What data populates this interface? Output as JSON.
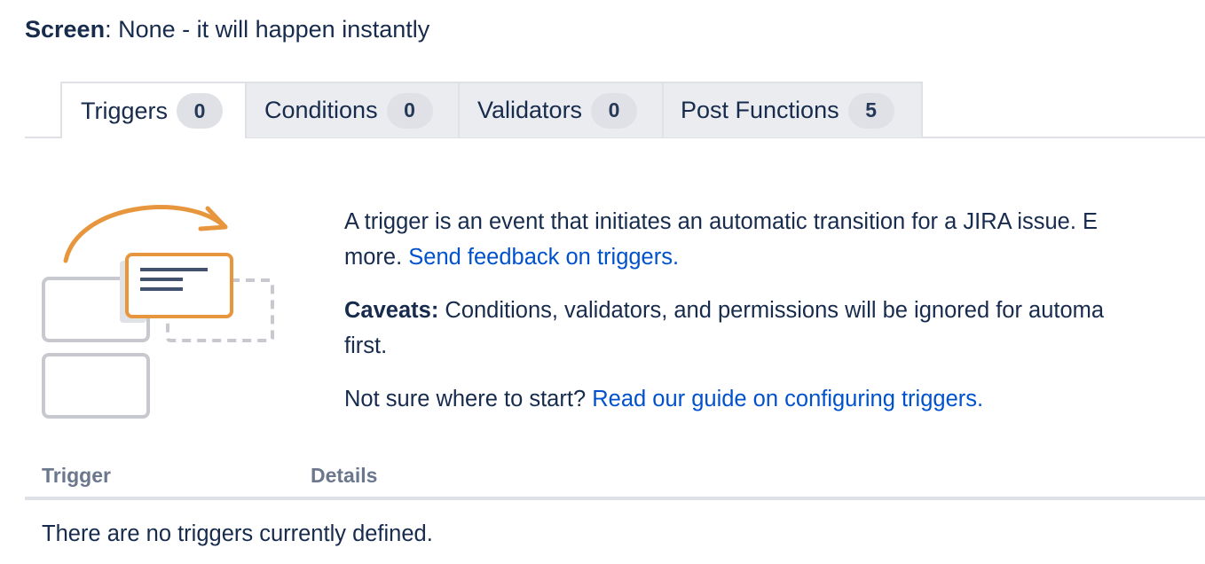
{
  "screen": {
    "label": "Screen",
    "value": ": None - it will happen instantly"
  },
  "tabs": [
    {
      "label": "Triggers",
      "count": "0",
      "active": true
    },
    {
      "label": "Conditions",
      "count": "0",
      "active": false
    },
    {
      "label": "Validators",
      "count": "0",
      "active": false
    },
    {
      "label": "Post Functions",
      "count": "5",
      "active": false
    }
  ],
  "illustration": {
    "icon": "trigger-transition-illustration",
    "accent_color": "#e8963d"
  },
  "description": {
    "intro_line1": "A trigger is an event that initiates an automatic transition for a JIRA issue. E",
    "intro_line2": "more. ",
    "feedback_link": "Send feedback on triggers.",
    "caveats_label": "Caveats:",
    "caveats_line1": " Conditions, validators, and permissions will be ignored for automa",
    "caveats_line2": "first.",
    "guide_prefix": "Not sure where to start? ",
    "guide_link": "Read our guide on configuring triggers."
  },
  "table": {
    "headers": [
      "Trigger",
      "Details"
    ],
    "empty_message": "There are no triggers currently defined."
  },
  "colors": {
    "text": "#172b4d",
    "link": "#0052cc",
    "muted": "#6b778c",
    "tab_bg": "#ebecf0",
    "badge_bg": "#dfe1e6"
  }
}
